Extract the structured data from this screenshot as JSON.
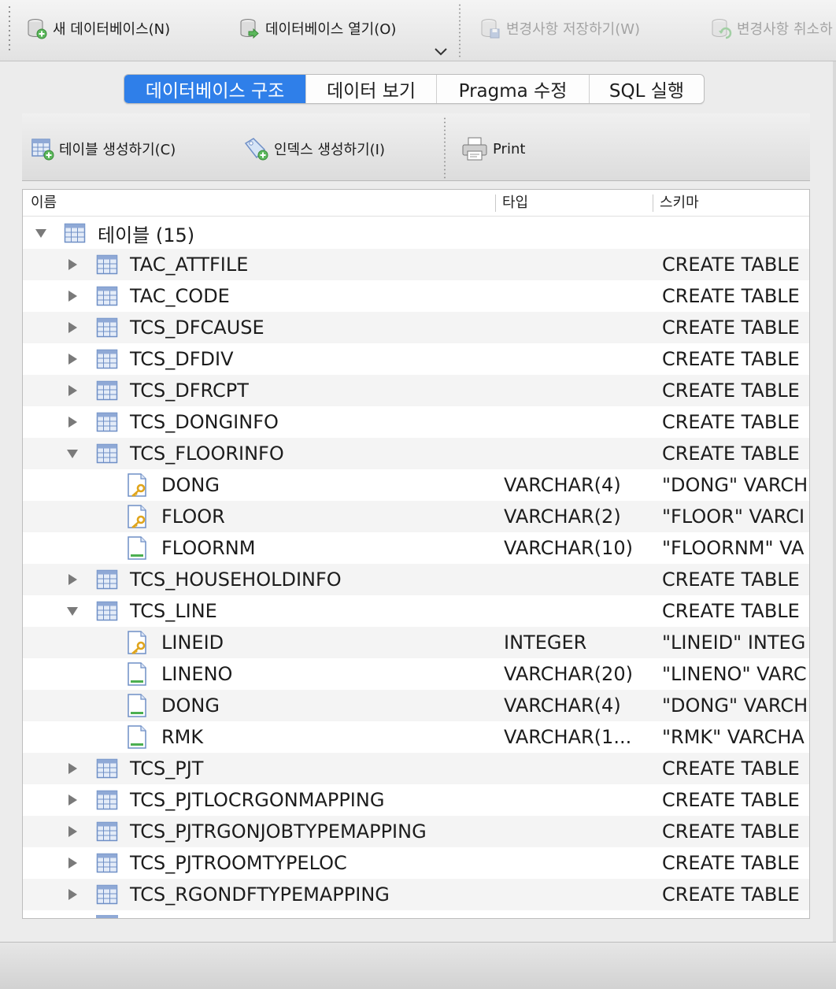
{
  "toolbar": {
    "new_db": "새 데이터베이스(N)",
    "open_db": "데이터베이스 열기(O)",
    "save_changes": "변경사항 저장하기(W)",
    "revert_changes": "변경사항 취소하"
  },
  "tabs": [
    {
      "label": "데이터베이스 구조",
      "active": true
    },
    {
      "label": "데이터 보기",
      "active": false
    },
    {
      "label": "Pragma 수정",
      "active": false
    },
    {
      "label": "SQL 실행",
      "active": false
    }
  ],
  "structure_toolbar": {
    "create_table": "테이블 생성하기(C)",
    "create_index": "인덱스 생성하기(I)",
    "print": "Print"
  },
  "tree": {
    "columns": {
      "name": "이름",
      "type": "타입",
      "schema": "스키마"
    },
    "root_label": "테이블 (15)",
    "rows": [
      {
        "kind": "table",
        "name": "TAC_ATTFILE",
        "type": "",
        "schema": "CREATE TABLE",
        "expanded": false
      },
      {
        "kind": "table",
        "name": "TAC_CODE",
        "type": "",
        "schema": "CREATE TABLE",
        "expanded": false
      },
      {
        "kind": "table",
        "name": "TCS_DFCAUSE",
        "type": "",
        "schema": "CREATE TABLE",
        "expanded": false
      },
      {
        "kind": "table",
        "name": "TCS_DFDIV",
        "type": "",
        "schema": "CREATE TABLE",
        "expanded": false
      },
      {
        "kind": "table",
        "name": "TCS_DFRCPT",
        "type": "",
        "schema": "CREATE TABLE",
        "expanded": false
      },
      {
        "kind": "table",
        "name": "TCS_DONGINFO",
        "type": "",
        "schema": "CREATE TABLE",
        "expanded": false
      },
      {
        "kind": "table",
        "name": "TCS_FLOORINFO",
        "type": "",
        "schema": "CREATE TABLE",
        "expanded": true
      },
      {
        "kind": "field",
        "name": "DONG",
        "type": "VARCHAR(4)",
        "schema": "\"DONG\" VARCH",
        "key": true
      },
      {
        "kind": "field",
        "name": "FLOOR",
        "type": "VARCHAR(2)",
        "schema": "\"FLOOR\" VARCI",
        "key": true
      },
      {
        "kind": "field",
        "name": "FLOORNM",
        "type": "VARCHAR(10)",
        "schema": "\"FLOORNM\" VA",
        "key": false
      },
      {
        "kind": "table",
        "name": "TCS_HOUSEHOLDINFO",
        "type": "",
        "schema": "CREATE TABLE",
        "expanded": false
      },
      {
        "kind": "table",
        "name": "TCS_LINE",
        "type": "",
        "schema": "CREATE TABLE",
        "expanded": true
      },
      {
        "kind": "field",
        "name": "LINEID",
        "type": "INTEGER",
        "schema": "\"LINEID\" INTEG",
        "key": true
      },
      {
        "kind": "field",
        "name": "LINENO",
        "type": "VARCHAR(20)",
        "schema": "\"LINENO\" VARC",
        "key": false
      },
      {
        "kind": "field",
        "name": "DONG",
        "type": "VARCHAR(4)",
        "schema": "\"DONG\" VARCH",
        "key": false
      },
      {
        "kind": "field",
        "name": "RMK",
        "type": "VARCHAR(1...",
        "schema": "\"RMK\" VARCHA",
        "key": false
      },
      {
        "kind": "table",
        "name": "TCS_PJT",
        "type": "",
        "schema": "CREATE TABLE",
        "expanded": false
      },
      {
        "kind": "table",
        "name": "TCS_PJTLOCRGONMAPPING",
        "type": "",
        "schema": "CREATE TABLE",
        "expanded": false
      },
      {
        "kind": "table",
        "name": "TCS_PJTRGONJOBTYPEMAPPING",
        "type": "",
        "schema": "CREATE TABLE",
        "expanded": false
      },
      {
        "kind": "table",
        "name": "TCS_PJTROOMTYPELOC",
        "type": "",
        "schema": "CREATE TABLE",
        "expanded": false
      },
      {
        "kind": "table",
        "name": "TCS_RGONDFTYPEMAPPING",
        "type": "",
        "schema": "CREATE TABLE",
        "expanded": false
      }
    ]
  },
  "colors": {
    "accent": "#2f7fe9",
    "icon_blue": "#6f8fc6",
    "icon_green": "#4caf50",
    "key_gold": "#e0a51c"
  }
}
